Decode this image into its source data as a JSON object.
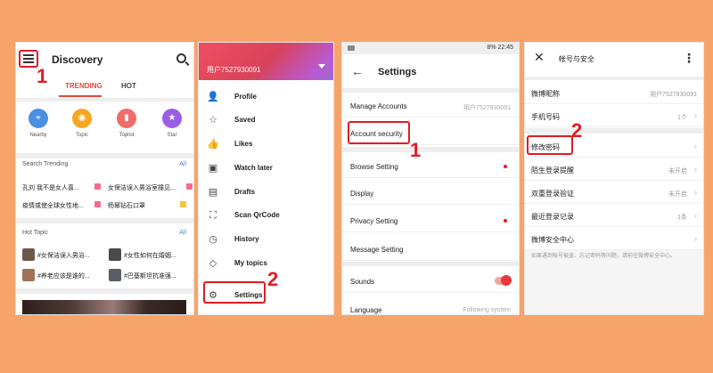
{
  "panel1": {
    "title": "Discovery",
    "tabs": [
      "TRENDING",
      "HOT"
    ],
    "shortcuts": [
      {
        "label": "Nearby",
        "color": "#4a90e2",
        "glyph": "⌖"
      },
      {
        "label": "Topic",
        "color": "#f5a623",
        "glyph": "◉"
      },
      {
        "label": "Toplist",
        "color": "#f06b6b",
        "glyph": "▮"
      },
      {
        "label": "Star",
        "color": "#9b5de5",
        "glyph": "★"
      }
    ],
    "search_trending_title": "Search Trending",
    "search_trending_all": "All",
    "trending": [
      {
        "text": "孔刘 我不是女人喜...",
        "badge": "#f36c8c"
      },
      {
        "text": "女保洁误入男浴室撞见...",
        "badge": "#f36c8c"
      },
      {
        "text": "疫情或使全球女性地...",
        "badge": "#f36c8c"
      },
      {
        "text": "杨幂钻石口罩",
        "badge": "#f5c542"
      }
    ],
    "hot_topic_title": "Hot Topic",
    "hot_topic_all": "All",
    "topics": [
      "#女保洁误入男浴...",
      "#女性如何在婚姻...",
      "#养老应该是谁的...",
      "#巴基斯坦抗准强..."
    ],
    "step_number": "1"
  },
  "panel2": {
    "username": "用户7527930091",
    "menu": [
      {
        "label": "Profile",
        "icon": "person-icon",
        "glyph": "👤"
      },
      {
        "label": "Saved",
        "icon": "star-icon",
        "glyph": "☆"
      },
      {
        "label": "Likes",
        "icon": "thumb-up-icon",
        "glyph": "👍"
      },
      {
        "label": "Watch later",
        "icon": "watch-later-icon",
        "glyph": "▣"
      },
      {
        "label": "Drafts",
        "icon": "drafts-icon",
        "glyph": "▤"
      },
      {
        "label": "Scan QrCode",
        "icon": "scan-icon",
        "glyph": "⛶"
      },
      {
        "label": "History",
        "icon": "history-icon",
        "glyph": "◷"
      },
      {
        "label": "My topics",
        "icon": "topics-icon",
        "glyph": "◇"
      },
      {
        "label": "Settings",
        "icon": "settings-icon",
        "glyph": "⚙"
      }
    ],
    "step_number": "2"
  },
  "panel3": {
    "status": "8% 22:45",
    "title": "Settings",
    "rows": [
      {
        "label": "Manage Accounts",
        "value": "用户7527930091"
      },
      {
        "label": "Account security",
        "value": ""
      },
      {
        "label": "Browse Setting",
        "value": "",
        "dot": true
      },
      {
        "label": "Display",
        "value": ""
      },
      {
        "label": "Privacy Setting",
        "value": "",
        "dot": true
      },
      {
        "label": "Message Setting",
        "value": ""
      },
      {
        "label": "Sounds",
        "value": ""
      },
      {
        "label": "Language",
        "value": "Following system"
      }
    ],
    "step_number": "1"
  },
  "panel4": {
    "title": "帐号与安全",
    "rows": [
      {
        "label": "微博昵称",
        "value": "用户7527930091"
      },
      {
        "label": "手机号码",
        "value": "1个"
      },
      {
        "label": "修改密码",
        "value": ""
      },
      {
        "label": "陌生登录提醒",
        "value": "未开启"
      },
      {
        "label": "双重登录验证",
        "value": "未开启"
      },
      {
        "label": "最近登录记录",
        "value": "1条"
      },
      {
        "label": "微博安全中心",
        "value": ""
      }
    ],
    "note": "如果遇到帐号被盗、忘记密码等问题，请前往微博安全中心。",
    "step_number": "2"
  }
}
